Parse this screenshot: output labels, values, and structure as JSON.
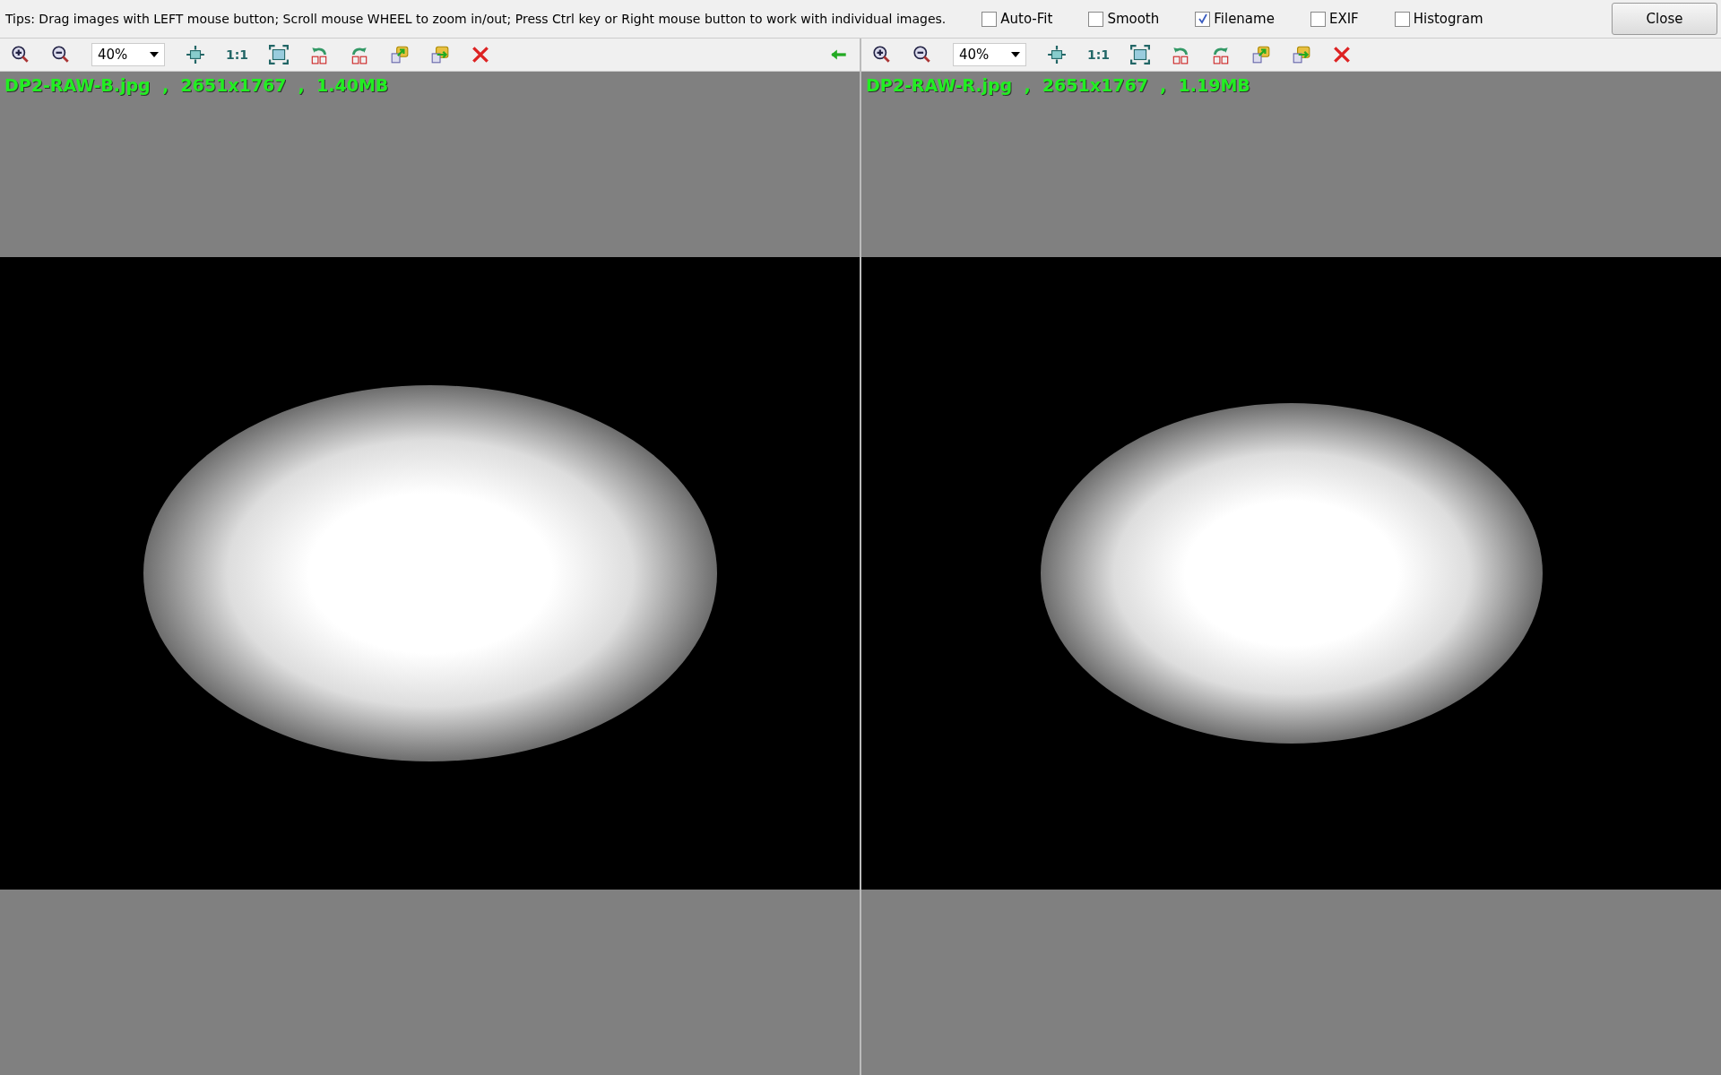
{
  "tips": "Tips: Drag images with LEFT mouse button; Scroll mouse WHEEL to zoom in/out; Press Ctrl key or Right mouse button to work with individual images.",
  "options": [
    {
      "label": "Auto-Fit",
      "checked": false
    },
    {
      "label": "Smooth",
      "checked": false
    },
    {
      "label": "Filename",
      "checked": true
    },
    {
      "label": "EXIF",
      "checked": false
    },
    {
      "label": "Histogram",
      "checked": false
    }
  ],
  "close_button": "Close",
  "panes": [
    {
      "zoom": "40%",
      "actual_size": "1:1",
      "caption": "DP2-RAW-B.jpg  ,  2651x1767  ,  1.40MB",
      "sync_arrow": true
    },
    {
      "zoom": "40%",
      "actual_size": "1:1",
      "caption": "DP2-RAW-R.jpg  ,  2651x1767  ,  1.19MB",
      "sync_arrow": false
    }
  ]
}
